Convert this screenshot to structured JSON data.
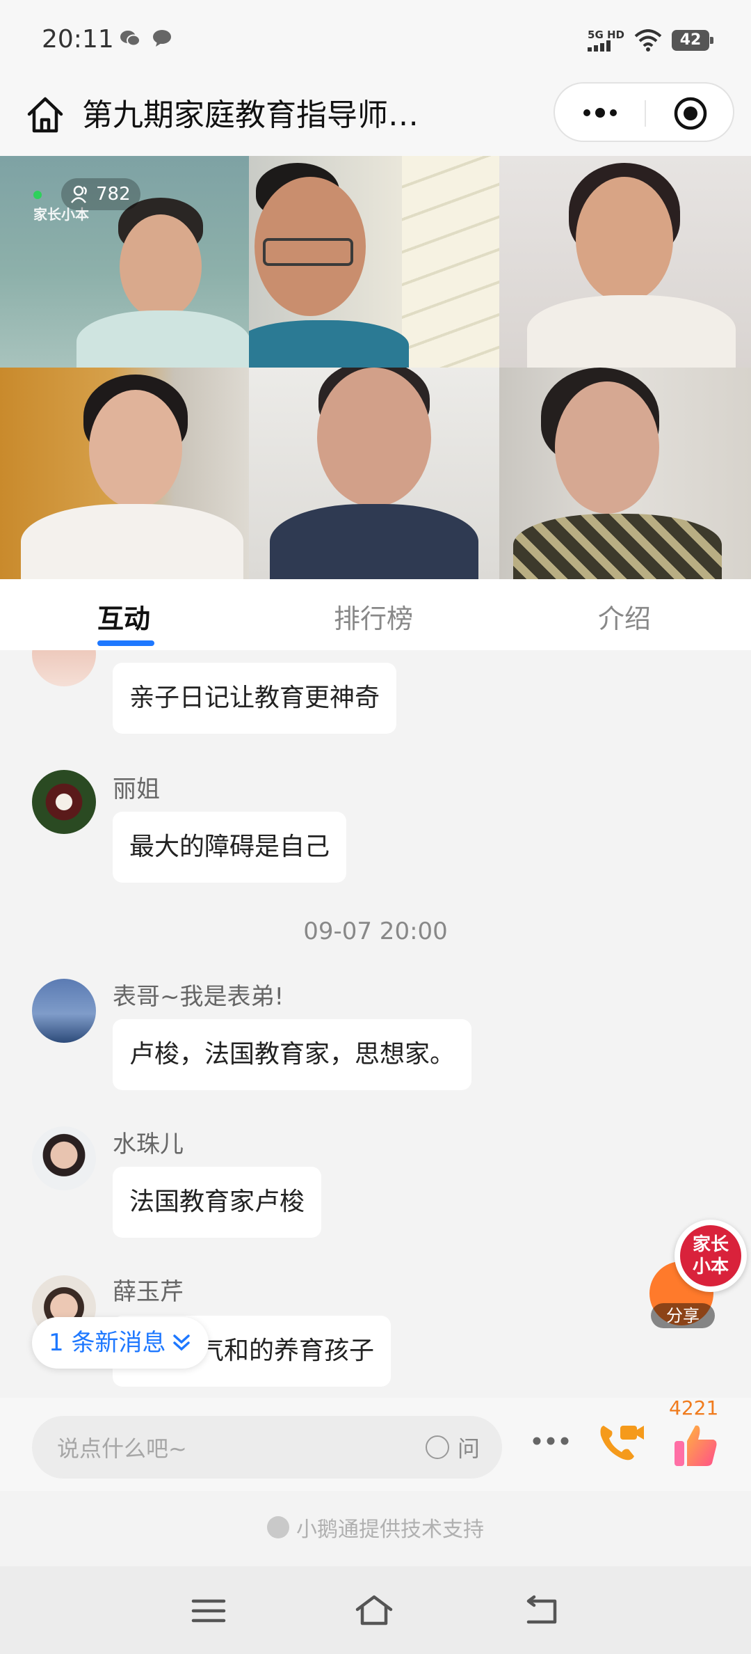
{
  "status_bar": {
    "time": "20:11",
    "network_top": "5G HD",
    "battery": "42"
  },
  "title_bar": {
    "title": "第九期家庭教育指导师…"
  },
  "video": {
    "viewer_count": "782",
    "watermark": "家长小本"
  },
  "tabs": [
    {
      "label": "互动"
    },
    {
      "label": "排行榜"
    },
    {
      "label": "介绍"
    }
  ],
  "chat": {
    "messages": [
      {
        "nickname": "",
        "text": "亲子日记让教育更神奇"
      },
      {
        "nickname": "丽姐",
        "text": "最大的障碍是自己"
      },
      {
        "nickname": "表哥~我是表弟!",
        "text": "卢梭，法国教育家，思想家。"
      },
      {
        "nickname": "水珠儿",
        "text": "法国教育家卢梭"
      },
      {
        "nickname": "薛玉芹",
        "text": "气和的养育孩子"
      }
    ],
    "timestamp": "09-07 20:00",
    "new_messages": "1 条新消息"
  },
  "share": {
    "label": "分享",
    "brand_line1": "家长",
    "brand_line2": "小本"
  },
  "input_bar": {
    "placeholder": "说点什么吧~",
    "ask_label": "问",
    "like_count": "4221"
  },
  "footer": {
    "support_text": "小鹅通提供技术支持"
  },
  "colors": {
    "accent": "#1e78ff",
    "like_orange": "#f07b1d",
    "brand_red": "#d9223b"
  }
}
